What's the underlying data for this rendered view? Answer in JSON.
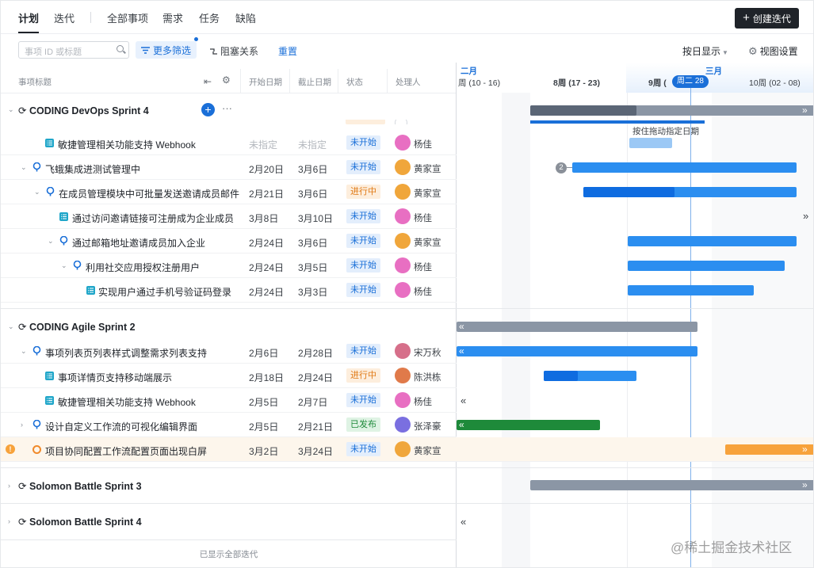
{
  "nav": {
    "tabs": [
      {
        "label": "计划",
        "active": true
      },
      {
        "label": "迭代"
      },
      {
        "label": "全部事项"
      },
      {
        "label": "需求"
      },
      {
        "label": "任务"
      },
      {
        "label": "缺陷"
      }
    ],
    "create_button": "创建迭代"
  },
  "toolbar": {
    "search_placeholder": "事项 ID 或标题",
    "more_filters": "更多筛选",
    "blocking": "阻塞关系",
    "reset": "重置",
    "display_mode": "按日显示",
    "view_settings": "视图设置"
  },
  "columns": {
    "title": "事项标题",
    "start": "开始日期",
    "end": "截止日期",
    "status": "状态",
    "assignee": "处理人"
  },
  "gantt": {
    "months": [
      "二月",
      "三月"
    ],
    "weeks": [
      "周 (10 - 16)",
      "8周 (17 - 23)",
      "9周 (",
      "10周 (02 - 08)"
    ],
    "today": "周二 28",
    "drag_hint": "按住拖动指定日期",
    "dep_count": "2"
  },
  "sprints": [
    {
      "name": "CODING DevOps Sprint 4"
    },
    {
      "name": "CODING Agile Sprint 2"
    },
    {
      "name": "Solomon Battle Sprint 3"
    },
    {
      "name": "Solomon Battle Sprint 4"
    }
  ],
  "rows": [
    {
      "title": "敏捷管理相关功能支持 Webhook",
      "start": "未指定",
      "end": "未指定",
      "status": "未开始",
      "assignee": "杨佳"
    },
    {
      "title": "飞蛾集成进测试管理中",
      "start": "2月20日",
      "end": "3月6日",
      "status": "未开始",
      "assignee": "黄家宣"
    },
    {
      "title": "在成员管理模块中可批量发送邀请成员邮件",
      "start": "2月21日",
      "end": "3月6日",
      "status": "进行中",
      "assignee": "黄家宣"
    },
    {
      "title": "通过访问邀请链接可注册成为企业成员",
      "start": "3月8日",
      "end": "3月10日",
      "status": "未开始",
      "assignee": "杨佳"
    },
    {
      "title": "通过邮箱地址邀请成员加入企业",
      "start": "2月24日",
      "end": "3月6日",
      "status": "未开始",
      "assignee": "黄家宣"
    },
    {
      "title": "利用社交应用授权注册用户",
      "start": "2月24日",
      "end": "3月5日",
      "status": "未开始",
      "assignee": "杨佳"
    },
    {
      "title": "实现用户通过手机号验证码登录",
      "start": "2月24日",
      "end": "3月3日",
      "status": "未开始",
      "assignee": "杨佳"
    },
    {
      "title": "事项列表页列表样式调整需求列表支持",
      "start": "2月6日",
      "end": "2月28日",
      "status": "未开始",
      "assignee": "宋万秋"
    },
    {
      "title": "事项详情页支持移动端展示",
      "start": "2月18日",
      "end": "2月24日",
      "status": "进行中",
      "assignee": "陈洪栋"
    },
    {
      "title": "敏捷管理相关功能支持 Webhook",
      "start": "2月5日",
      "end": "2月7日",
      "status": "未开始",
      "assignee": "杨佳"
    },
    {
      "title": "设计自定义工作流的可视化编辑界面",
      "start": "2月5日",
      "end": "2月21日",
      "status": "已发布",
      "assignee": "张泽豪"
    },
    {
      "title": "项目协同配置工作流配置页面出现白屏",
      "start": "3月2日",
      "end": "3月24日",
      "status": "未开始",
      "assignee": "黄家宣"
    }
  ],
  "footer": "已显示全部迭代",
  "watermark": "@稀土掘金技术社区",
  "colors": {
    "accent": "#1a6fd8",
    "dark": "#1f2329",
    "bar_blue": "#2b8ef0",
    "bar_gray": "#8b96a5",
    "bar_green": "#1e8a3a",
    "bar_orange": "#f7a23b"
  }
}
